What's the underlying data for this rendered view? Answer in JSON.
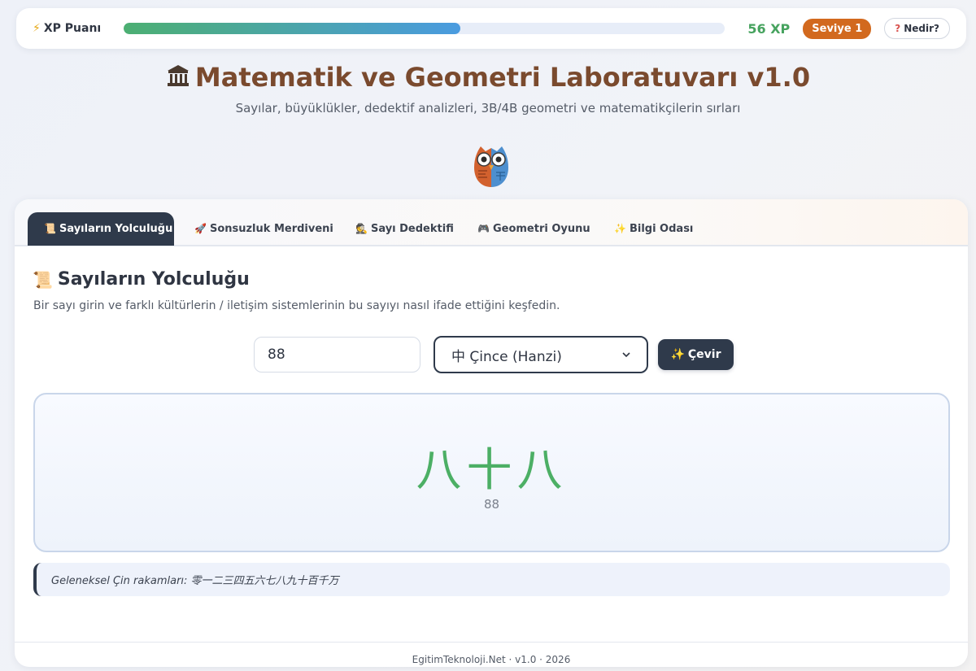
{
  "xp": {
    "label": "XP Puanı",
    "progress_percent": 56,
    "value": "56 XP",
    "level": "Seviye 1",
    "help_label": "Nedir?"
  },
  "header": {
    "title": "Matematik ve Geometri Laboratuvarı v1.0",
    "subtitle": "Sayılar, büyüklükler, dedektif analizleri, 3B/4B geometri ve matematikçilerin sırları"
  },
  "tabs": [
    {
      "label": "Sayıların Yolculuğu",
      "icon": "scroll-icon",
      "active": true
    },
    {
      "label": "Sonsuzluk Merdiveni",
      "icon": "rocket-icon",
      "active": false
    },
    {
      "label": "Sayı Dedektifi",
      "icon": "detective-icon",
      "active": false
    },
    {
      "label": "Geometri Oyunu",
      "icon": "gamepad-icon",
      "active": false
    },
    {
      "label": "Bilgi Odası",
      "icon": "sparkles-icon",
      "active": false
    }
  ],
  "section": {
    "title": "Sayıların Yolculuğu",
    "description": "Bir sayı girin ve farklı kültürlerin / iletişim sistemlerinin bu sayıyı nasıl ifade ettiğini keşfedin."
  },
  "converter": {
    "input_value": "88",
    "selected_system": "中 Çince (Hanzi)",
    "convert_label": "Çevir"
  },
  "result": {
    "glyph": "八十八",
    "number": "88"
  },
  "note": "Geleneksel Çin rakamları: 零一二三四五六七八九十百千万",
  "footer": "EgitimTeknoloji.Net · v1.0 · 2026",
  "colors": {
    "primary_dark": "#2f3a4b",
    "title_brown": "#7a4a2e",
    "xp_green": "#47a35f",
    "level_orange": "#d2691e",
    "result_green": "#4caf65"
  }
}
